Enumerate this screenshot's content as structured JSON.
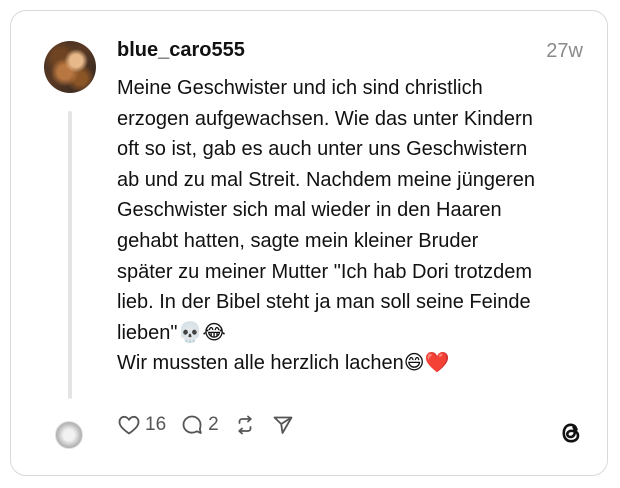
{
  "post": {
    "username": "blue_caro555",
    "timestamp": "27w",
    "lines": [
      "Meine Geschwister und ich sind christlich",
      "erzogen aufgewachsen. Wie das unter Kindern",
      "oft so ist, gab es auch unter uns Geschwistern",
      "ab und zu mal Streit. Nachdem meine jüngeren",
      "Geschwister sich mal wieder in den Haaren",
      "gehabt hatten, sagte mein kleiner Bruder",
      "später zu meiner Mutter \"Ich hab Dori trotzdem",
      "lieb. In der Bibel steht ja man soll seine Feinde",
      "lieben\"💀😂",
      "Wir mussten alle herzlich lachen😄❤️"
    ]
  },
  "actions": {
    "likes": "16",
    "comments": "2"
  },
  "icons": {
    "like": "heart-icon",
    "comment": "comment-bubble-icon",
    "repost": "repost-icon",
    "share": "send-icon",
    "brand": "threads-logo-icon"
  }
}
